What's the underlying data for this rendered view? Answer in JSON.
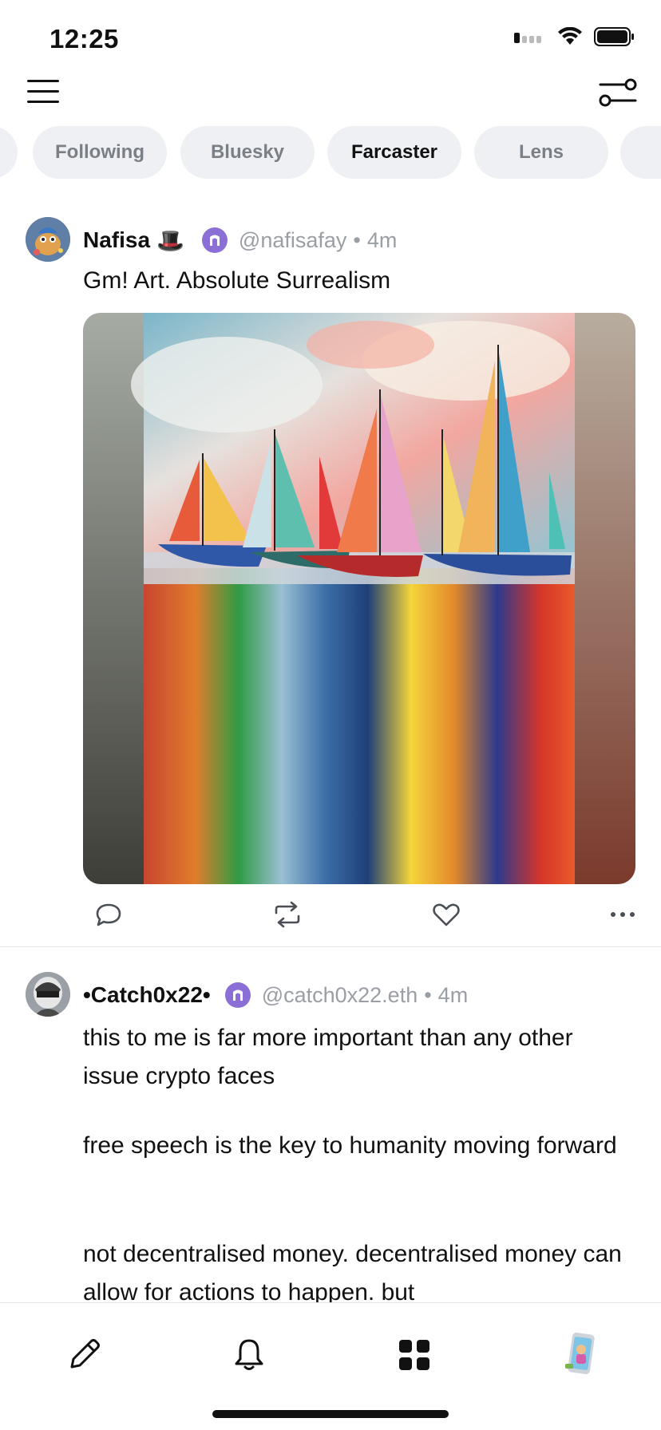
{
  "status": {
    "time": "12:25",
    "icons": [
      "signal-icon",
      "wifi-icon",
      "battery-icon"
    ]
  },
  "nav": {
    "menu_icon": "hamburger-menu-icon",
    "filter_icon": "sliders-icon"
  },
  "tabs": [
    {
      "label": "Following",
      "active": false
    },
    {
      "label": "Bluesky",
      "active": false
    },
    {
      "label": "Farcaster",
      "active": true
    },
    {
      "label": "Lens",
      "active": false
    }
  ],
  "posts": [
    {
      "author": "Nafisa",
      "emoji": "🎩",
      "protocol_icon": "farcaster-icon",
      "handle": "@nafisafay",
      "separator": "•",
      "time": "4m",
      "text": "Gm! Art. Absolute Surrealism",
      "media": "sailboats-painting"
    },
    {
      "author": "•Catch0x22•",
      "protocol_icon": "farcaster-icon",
      "handle": "@catch0x22.eth",
      "separator": "•",
      "time": "4m",
      "paragraphs": [
        "this to me is far more important than any other issue crypto faces",
        "free speech is the key to humanity moving forward",
        "not decentralised money. decentralised money can allow for actions to happen. but"
      ]
    }
  ],
  "actions": [
    "reply-icon",
    "repost-icon",
    "like-icon",
    "more-icon"
  ],
  "bottom_nav": [
    "compose-icon",
    "notifications-icon",
    "apps-grid-icon",
    "profile-avatar"
  ],
  "colors": {
    "farcaster": "#8b6fd6",
    "tab_bg": "#eef0f3",
    "muted": "#9a9ea5"
  }
}
